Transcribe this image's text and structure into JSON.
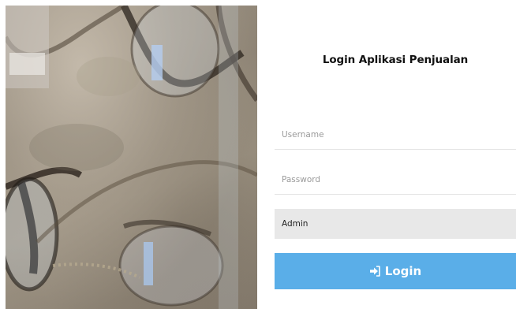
{
  "form": {
    "title": "Login Aplikasi Penjualan",
    "username_placeholder": "Username",
    "password_placeholder": "Password",
    "role_selected": "Admin",
    "login_label": "Login",
    "login_icon": "sign-in-icon"
  },
  "colors": {
    "button_bg": "#5aaee8",
    "select_bg": "#e8e8e8"
  }
}
